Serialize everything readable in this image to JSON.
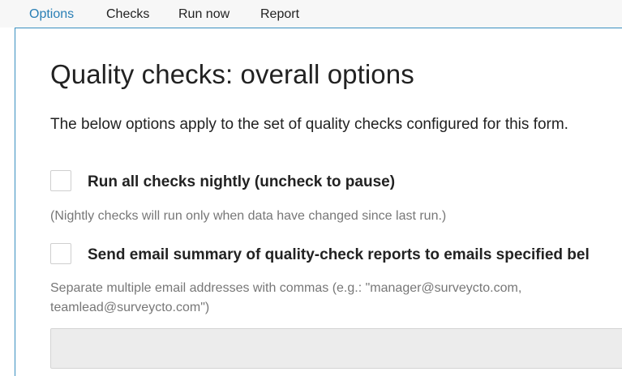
{
  "tabs": [
    {
      "label": "Options",
      "active": true
    },
    {
      "label": "Checks",
      "active": false
    },
    {
      "label": "Run now",
      "active": false
    },
    {
      "label": "Report",
      "active": false
    }
  ],
  "page": {
    "title": "Quality checks: overall options",
    "intro": "The below options apply to the set of quality checks configured for this form."
  },
  "options": {
    "nightly": {
      "label": "Run all checks nightly (uncheck to pause)",
      "checked": false,
      "help": "(Nightly checks will run only when data have changed since last run.)"
    },
    "email": {
      "label": "Send email summary of quality-check reports to emails specified bel",
      "checked": false,
      "help_line1": "Separate multiple email addresses with commas (e.g.: \"manager@surveycto.com,",
      "help_line2": "teamlead@surveycto.com\")",
      "input_value": ""
    }
  },
  "colors": {
    "accent": "#2a7fb5",
    "panel_border": "#3a90c0",
    "input_bg": "#ececec",
    "help_text": "#777777"
  }
}
